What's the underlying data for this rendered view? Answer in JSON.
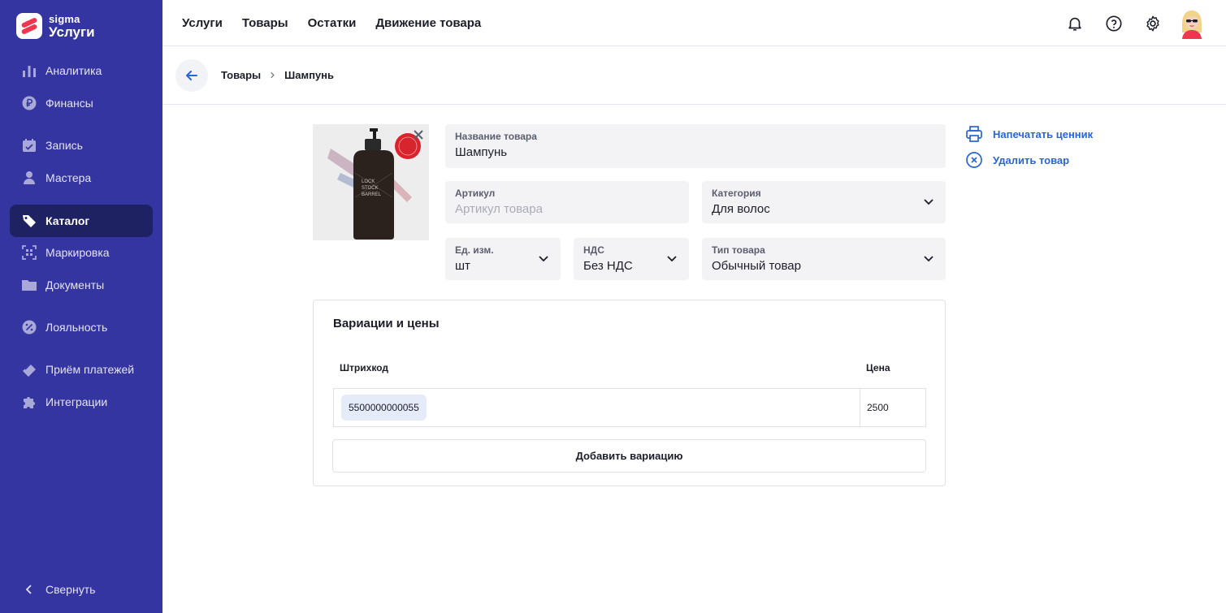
{
  "brand": {
    "top": "sigma",
    "bottom": "Услуги"
  },
  "sidebar": {
    "items": [
      {
        "label": "Аналитика",
        "icon": "bar-chart-icon"
      },
      {
        "label": "Финансы",
        "icon": "ruble-coin-icon"
      },
      {
        "label": "Запись",
        "icon": "calendar-icon"
      },
      {
        "label": "Мастера",
        "icon": "person-icon"
      },
      {
        "label": "Каталог",
        "icon": "tag-icon",
        "active": true
      },
      {
        "label": "Маркировка",
        "icon": "qr-scan-icon"
      },
      {
        "label": "Документы",
        "icon": "folder-icon"
      },
      {
        "label": "Лояльность",
        "icon": "percent-badge-icon"
      },
      {
        "label": "Приём платежей",
        "icon": "card-icon"
      },
      {
        "label": "Интеграции",
        "icon": "puzzle-icon"
      }
    ],
    "collapse_label": "Свернуть"
  },
  "topnav": {
    "items": [
      "Услуги",
      "Товары",
      "Остатки",
      "Движение товара"
    ]
  },
  "breadcrumb": {
    "parent": "Товары",
    "current": "Шампунь"
  },
  "product": {
    "name_label": "Название товара",
    "name_value": "Шампунь",
    "sku_label": "Артикул",
    "sku_placeholder": "Артикул товара",
    "category_label": "Категория",
    "category_value": "Для волос",
    "unit_label": "Ед. изм.",
    "unit_value": "шт",
    "vat_label": "НДС",
    "vat_value": "Без НДС",
    "type_label": "Тип товара",
    "type_value": "Обычный товар"
  },
  "actions": {
    "print_label": "Напечатать ценник",
    "delete_label": "Удалить товар"
  },
  "variations": {
    "title": "Вариации и цены",
    "col_barcode": "Штрихкод",
    "col_price": "Цена",
    "rows": [
      {
        "barcode": "5500000000055",
        "price": "2500"
      }
    ],
    "add_label": "Добавить вариацию"
  },
  "colors": {
    "sidebar_bg": "#3535a1",
    "sidebar_active": "#1f2262",
    "accent_blue": "#2a64d6",
    "brand_red": "#f0364e"
  }
}
